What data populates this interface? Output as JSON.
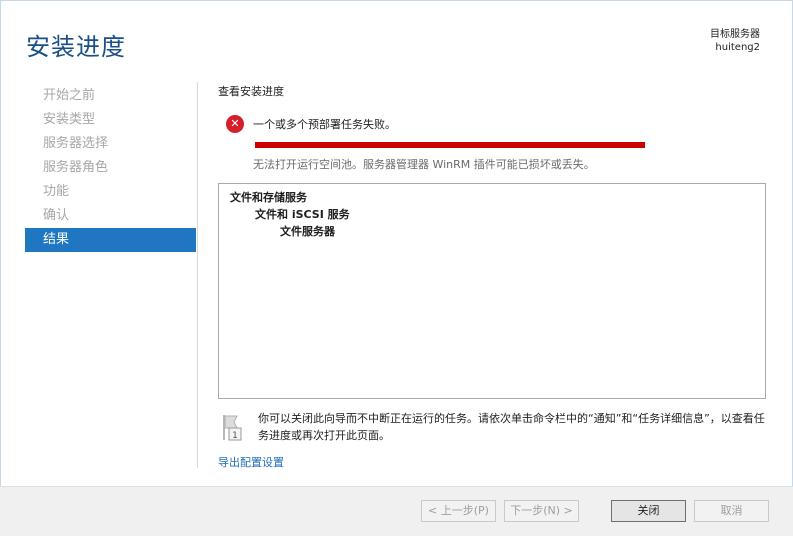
{
  "header": {
    "title": "安装进度",
    "target_server_label": "目标服务器",
    "target_server_name": "huiteng2"
  },
  "sidebar": {
    "items": [
      {
        "label": "开始之前",
        "state": "disabled"
      },
      {
        "label": "安装类型",
        "state": "disabled"
      },
      {
        "label": "服务器选择",
        "state": "disabled"
      },
      {
        "label": "服务器角色",
        "state": "disabled"
      },
      {
        "label": "功能",
        "state": "disabled"
      },
      {
        "label": "确认",
        "state": "disabled"
      },
      {
        "label": "结果",
        "state": "active"
      }
    ]
  },
  "main": {
    "section_title": "查看安装进度",
    "status": {
      "icon": "error-icon",
      "title": "一个或多个预部署任务失败。",
      "detail": "无法打开运行空间池。服务器管理器 WinRM 插件可能已损坏或丢失。",
      "progress": 1.0,
      "progress_color": "#cc0000"
    },
    "results": [
      {
        "text": "文件和存储服务",
        "level": 0
      },
      {
        "text": "文件和 iSCSI 服务",
        "level": 1
      },
      {
        "text": "文件服务器",
        "level": 2
      }
    ],
    "info_text": "你可以关闭此向导而不中断正在运行的任务。请依次单击命令栏中的“通知”和“任务详细信息”，以查看任务进度或再次打开此页面。",
    "export_link": "导出配置设置"
  },
  "footer": {
    "prev_label": "< 上一步(P)",
    "next_label": "下一步(N) >",
    "close_label": "关闭",
    "cancel_label": "取消"
  },
  "colors": {
    "accent": "#1e77c0",
    "title": "#1b4f86",
    "error": "#d4202b"
  }
}
